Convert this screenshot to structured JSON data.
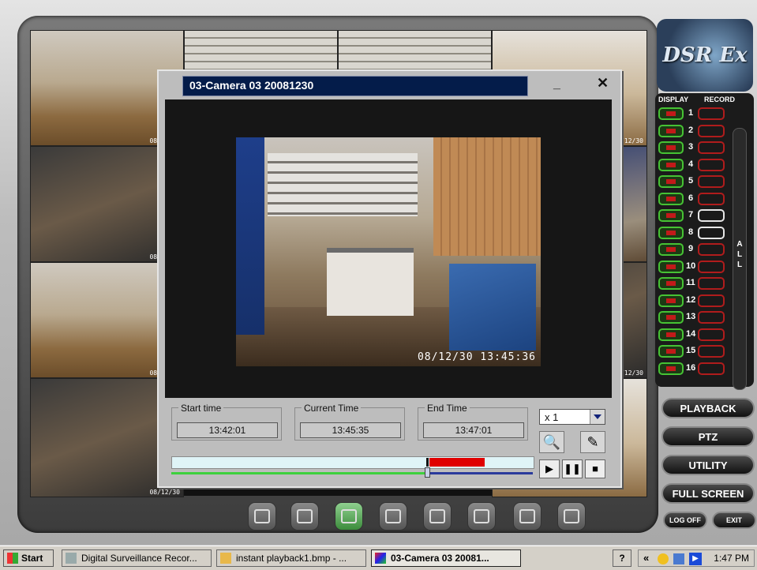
{
  "app": {
    "logo_text": "DSR Ex"
  },
  "camera_grid": {
    "timestamps": [
      "08/12/30",
      "08/12/30",
      "08/12/30",
      "08/12/30",
      "08/12/30",
      "08/12/30"
    ]
  },
  "camera_panel": {
    "display_label": "DISPLAY",
    "record_label": "RECORD",
    "all_label": "A\nL\nL",
    "cameras": [
      {
        "num": "1",
        "record": true
      },
      {
        "num": "2",
        "record": true
      },
      {
        "num": "3",
        "record": true
      },
      {
        "num": "4",
        "record": true
      },
      {
        "num": "5",
        "record": true
      },
      {
        "num": "6",
        "record": true
      },
      {
        "num": "7",
        "record": false
      },
      {
        "num": "8",
        "record": false
      },
      {
        "num": "9",
        "record": true
      },
      {
        "num": "10",
        "record": true
      },
      {
        "num": "11",
        "record": true
      },
      {
        "num": "12",
        "record": true
      },
      {
        "num": "13",
        "record": true
      },
      {
        "num": "14",
        "record": true
      },
      {
        "num": "15",
        "record": true
      },
      {
        "num": "16",
        "record": true
      }
    ]
  },
  "side_buttons": {
    "playback": "PLAYBACK",
    "ptz": "PTZ",
    "utility": "UTILITY",
    "full_screen": "FULL SCREEN",
    "log_off": "LOG OFF",
    "exit": "EXIT"
  },
  "dialog": {
    "title": "03-Camera 03  20081230",
    "minimize": "_",
    "close": "✕",
    "video_timestamp": "08/12/30  13:45:36",
    "start_label": "Start time",
    "start_value": "13:42:01",
    "current_label": "Current Time",
    "current_value": "13:45:35",
    "end_label": "End Time",
    "end_value": "13:47:01",
    "speed": "x 1",
    "progress_fraction": 0.71,
    "play": "▶",
    "pause": "❚❚",
    "stop": "■"
  },
  "taskbar": {
    "start": "Start",
    "tasks": [
      "Digital Surveillance Recor...",
      "instant playback1.bmp - ...",
      "03-Camera 03  20081..."
    ],
    "tray_chevron": "«",
    "clock": "1:47 PM"
  },
  "colors": {
    "title_bar": "#041c4a",
    "display_green": "#46c234",
    "record_red": "#b01c1c",
    "timeline_red": "#e00000"
  }
}
